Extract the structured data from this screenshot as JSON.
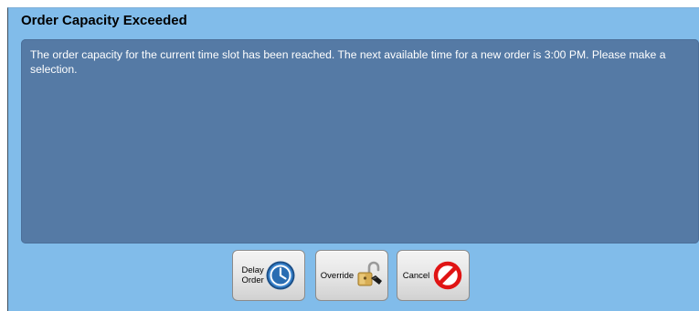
{
  "dialog": {
    "title": "Order Capacity Exceeded",
    "message": "The order capacity for the current time slot has been reached. The next available time for a new order is 3:00 PM. Please make a selection."
  },
  "buttons": {
    "delay_order": {
      "label": "Delay Order",
      "icon": "clock-icon"
    },
    "override": {
      "label": "Override",
      "icon": "unlock-icon"
    },
    "cancel": {
      "label": "Cancel",
      "icon": "no-entry-icon"
    }
  },
  "colors": {
    "dialog_background": "#81bcea",
    "message_background": "#557aa5",
    "cancel_red": "#e01414",
    "clock_blue": "#2a6db2"
  }
}
